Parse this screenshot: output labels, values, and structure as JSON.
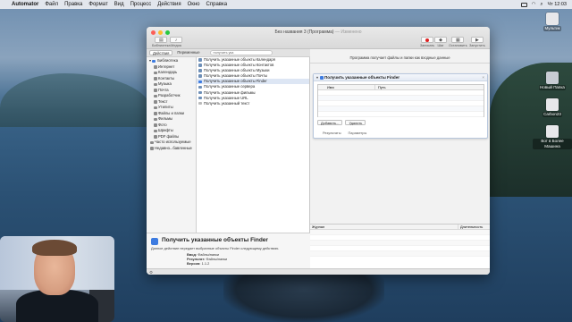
{
  "menubar": {
    "app_name": "Automator",
    "menus": [
      "Файл",
      "Правка",
      "Формат",
      "Вид",
      "Процесс",
      "Действия",
      "Окно",
      "Справка"
    ],
    "clock": "Чт 12:03"
  },
  "desktop_icons": [
    {
      "label": "Мультик"
    },
    {
      "label": "Новый Папка"
    },
    {
      "label": "Carbon23"
    },
    {
      "label": "Вот в Более Машина"
    }
  ],
  "window": {
    "title": "Без названия 3 (Программа)",
    "title_state": "— Изменено",
    "toolbar_left": [
      {
        "label": "Библиотека",
        "icon": "sidebar-icon"
      },
      {
        "label": "Медиа",
        "icon": "music-note-icon"
      }
    ],
    "toolbar_right": [
      {
        "label": "Записать",
        "icon": "record-icon"
      },
      {
        "label": "Шаг",
        "icon": "step-icon"
      },
      {
        "label": "Шаг",
        "icon": "step-icon"
      },
      {
        "label": "Остановить",
        "icon": "stop-icon"
      },
      {
        "label": "Запустить",
        "icon": "play-icon"
      }
    ],
    "tabs": [
      "Действия",
      "Переменные"
    ],
    "search_value": "получить ука",
    "library": {
      "root": "Библиотека",
      "items": [
        "Интернет",
        "Календарь",
        "Контакты",
        "Музыка",
        "Почта",
        "Разработчик",
        "Текст",
        "Утилиты",
        "Файлы и папки",
        "Фильмы",
        "Фото",
        "Шрифты",
        "PDF файлы"
      ],
      "extra": [
        "Часто используемые",
        "Недавно...бавленные"
      ]
    },
    "actions": [
      "Получить указанные объекты Календаря",
      "Получить указанные объекты Контактов",
      "Получить указанные объекты Музыки",
      "Получить указанные объекты Почты",
      "Получить указанные объекты Finder",
      "Получить указанные сервера",
      "Получить указанные фильмы",
      "Получить указанные URL",
      "Получить указанный текст"
    ],
    "selected_action_index": 4,
    "description": {
      "title": "Получить указанные объекты Finder",
      "text": "Данное действие передает выбранные объекты Finder следующему действию.",
      "input_label": "Ввод:",
      "input_value": "Файлы/папки",
      "result_label": "Результат:",
      "result_value": "Файлы/папки",
      "version_label": "Версия:",
      "version_value": "1.1.2"
    },
    "workflow": {
      "hint": "Программа получает файлы и папки как входные данные",
      "card_title": "Получить указанные объекты Finder",
      "col_name": "Имя",
      "col_path": "Путь",
      "add_button": "Добавить...",
      "remove_button": "Удалить",
      "card_tabs": [
        "Результаты",
        "Параметры"
      ]
    },
    "log": {
      "col_log": "Журнал",
      "col_duration": "Длительность"
    }
  }
}
